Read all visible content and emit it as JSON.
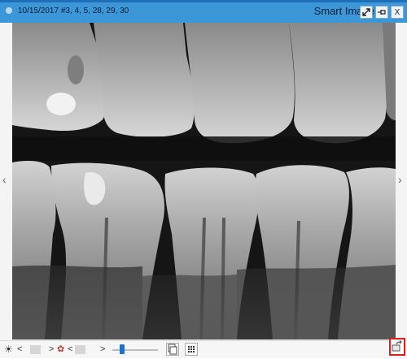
{
  "window": {
    "exam_info": "10/15/2017 #3, 4, 5, 28, 29, 30",
    "title": "Smart Image",
    "buttons": [
      "expand-icon",
      "pin-icon",
      "close-icon"
    ],
    "close_label": "X",
    "accent_color": "#3c97d9"
  },
  "viewer": {
    "image_subject": "dental bitewing x-ray",
    "prev_glyph": "‹",
    "next_glyph": "›"
  },
  "toolbar": {
    "brightness_glyph": "☀",
    "left_glyph": "<",
    "right_glyph": ">",
    "color_glyph": "✿",
    "zoom_level_fraction": 0.18
  }
}
